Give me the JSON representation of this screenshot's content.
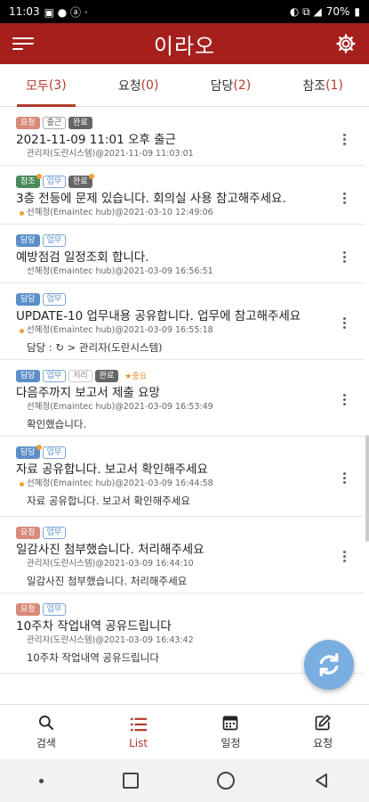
{
  "status": {
    "time": "11:03",
    "battery": "70%"
  },
  "header": {
    "title": "이라오"
  },
  "tabs": [
    {
      "label": "모두",
      "count": "(3)"
    },
    {
      "label": "요청",
      "count": "(0)"
    },
    {
      "label": "담당",
      "count": "(2)"
    },
    {
      "label": "참조",
      "count": "(1)"
    }
  ],
  "items": [
    {
      "title": "2021-11-09 11:01 오후 출근",
      "meta": "관리자(도란시스템)@2021-11-09 11:03:01"
    },
    {
      "title": "3층 전등에 문제 있습니다. 회의실 사용 참고해주세요.",
      "meta": "선혜정(Emaintec hub)@2021-03-10 12:49:06"
    },
    {
      "title": "예방점검 일정조회 합니다.",
      "meta": "선혜정(Emaintec hub)@2021-03-09 16:56:51"
    },
    {
      "title": "UPDATE-10 업무내용 공유합니다. 업무에 참고해주세요",
      "meta": "선혜정(Emaintec hub)@2021-03-09 16:55:18",
      "body": "담당 : ↻ > 관리자(도란시스템)"
    },
    {
      "title": "다음주까지 보고서 제출 요망",
      "meta": "선혜정(Emaintec hub)@2021-03-09 16:53:49",
      "body": "확인했습니다."
    },
    {
      "title": "자료 공유합니다. 보고서 확인해주세요",
      "meta": "선혜정(Emaintec hub)@2021-03-09 16:44:58",
      "body": "자료 공유합니다. 보고서 확인해주세요"
    },
    {
      "title": "일감사진 첨부했습니다. 처리해주세요",
      "meta": "관리자(도란시스템)@2021-03-09 16:44:10",
      "body": "일감사진 첨부했습니다. 처리해주세요"
    },
    {
      "title": "10주차 작업내역 공유드립니다",
      "meta": "관리자(도란시스템)@2021-03-09 16:43:42",
      "body": "10주차 작업내역 공유드립니다"
    }
  ],
  "badges": {
    "request": "요청",
    "reference": "참조",
    "owner": "담당",
    "work": "업무",
    "out": "출근",
    "done": "완료",
    "process": "처리",
    "important": "중요"
  },
  "bottom_nav": [
    {
      "label": "검색",
      "icon": "search-icon"
    },
    {
      "label": "List",
      "icon": "list-icon"
    },
    {
      "label": "일정",
      "icon": "calendar-icon"
    },
    {
      "label": "요청",
      "icon": "edit-icon"
    }
  ],
  "colors": {
    "brand": "#a51f1c",
    "accent": "#b23a2e",
    "fab": "#7aaee0"
  }
}
